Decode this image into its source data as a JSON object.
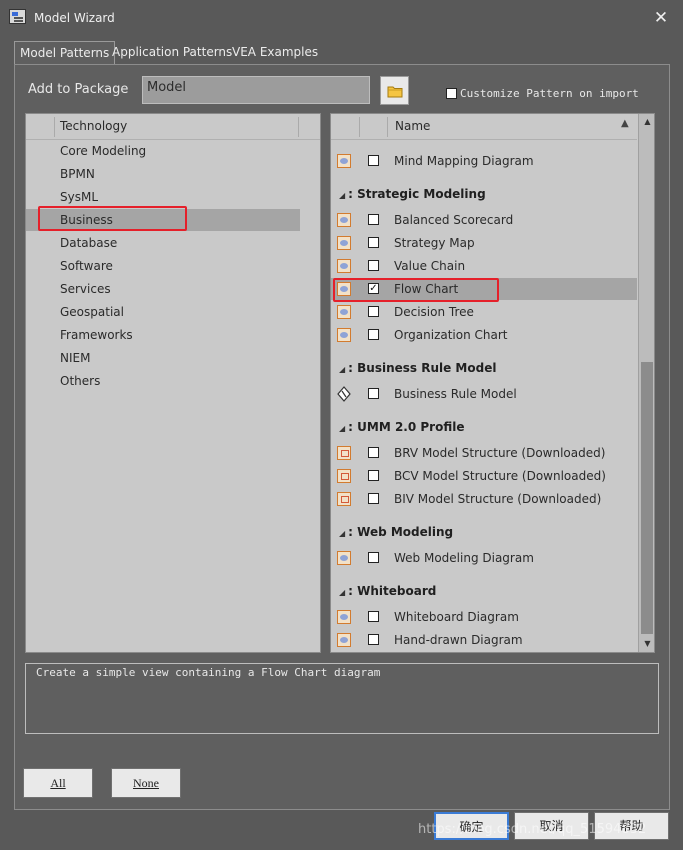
{
  "window": {
    "title": "Model Wizard",
    "close_icon": "close-icon"
  },
  "tabs": [
    {
      "label": "Model Patterns",
      "active": true
    },
    {
      "label": "Application Patterns",
      "active": false
    },
    {
      "label": "VEA Examples",
      "active": false
    }
  ],
  "package": {
    "label": "Add to Package",
    "value": "Model"
  },
  "customize": {
    "label": "Customize Pattern on import",
    "checked": false
  },
  "technology": {
    "header": "Technology",
    "items": [
      "Core Modeling",
      "BPMN",
      "SysML",
      "Business",
      "Database",
      "Software",
      "Services",
      "Geospatial",
      "Frameworks",
      "NIEM",
      "Others"
    ],
    "selected": "Business"
  },
  "patterns": {
    "header": "Name",
    "groups": [
      {
        "title": ": Strategic Modeling",
        "items": [
          {
            "label": "Balanced Scorecard",
            "checked": false
          },
          {
            "label": "Strategy Map",
            "checked": false
          },
          {
            "label": "Value Chain",
            "checked": false
          },
          {
            "label": "Flow Chart",
            "checked": true
          },
          {
            "label": "Decision Tree",
            "checked": false
          },
          {
            "label": "Organization Chart",
            "checked": false
          }
        ]
      },
      {
        "title": ": Business Rule Model",
        "items": [
          {
            "label": "Business Rule Model",
            "checked": false
          }
        ]
      },
      {
        "title": ": UMM 2.0 Profile",
        "items": [
          {
            "label": "BRV Model Structure (Downloaded)",
            "checked": false
          },
          {
            "label": "BCV Model Structure (Downloaded)",
            "checked": false
          },
          {
            "label": "BIV Model Structure (Downloaded)",
            "checked": false
          }
        ]
      },
      {
        "title": ": Web Modeling",
        "items": [
          {
            "label": "Web Modeling Diagram",
            "checked": false
          }
        ]
      },
      {
        "title": ": Whiteboard",
        "items": [
          {
            "label": "Whiteboard Diagram",
            "checked": false
          },
          {
            "label": "Hand-drawn Diagram",
            "checked": false
          }
        ]
      }
    ],
    "above": {
      "label": "Mind Mapping Diagram",
      "checked": false
    },
    "selected": "Flow Chart"
  },
  "description": "Create a simple view containing a Flow Chart diagram",
  "buttons": {
    "all": "All",
    "none": "None",
    "ok": "确定",
    "cancel": "取消",
    "help": "帮助"
  },
  "watermark": "https://blog.csdn.net/qq_51594832",
  "colors": {
    "highlight_red": "#e5202a",
    "panel_bg": "#5f5f5f",
    "list_bg": "#c9c9c9"
  }
}
